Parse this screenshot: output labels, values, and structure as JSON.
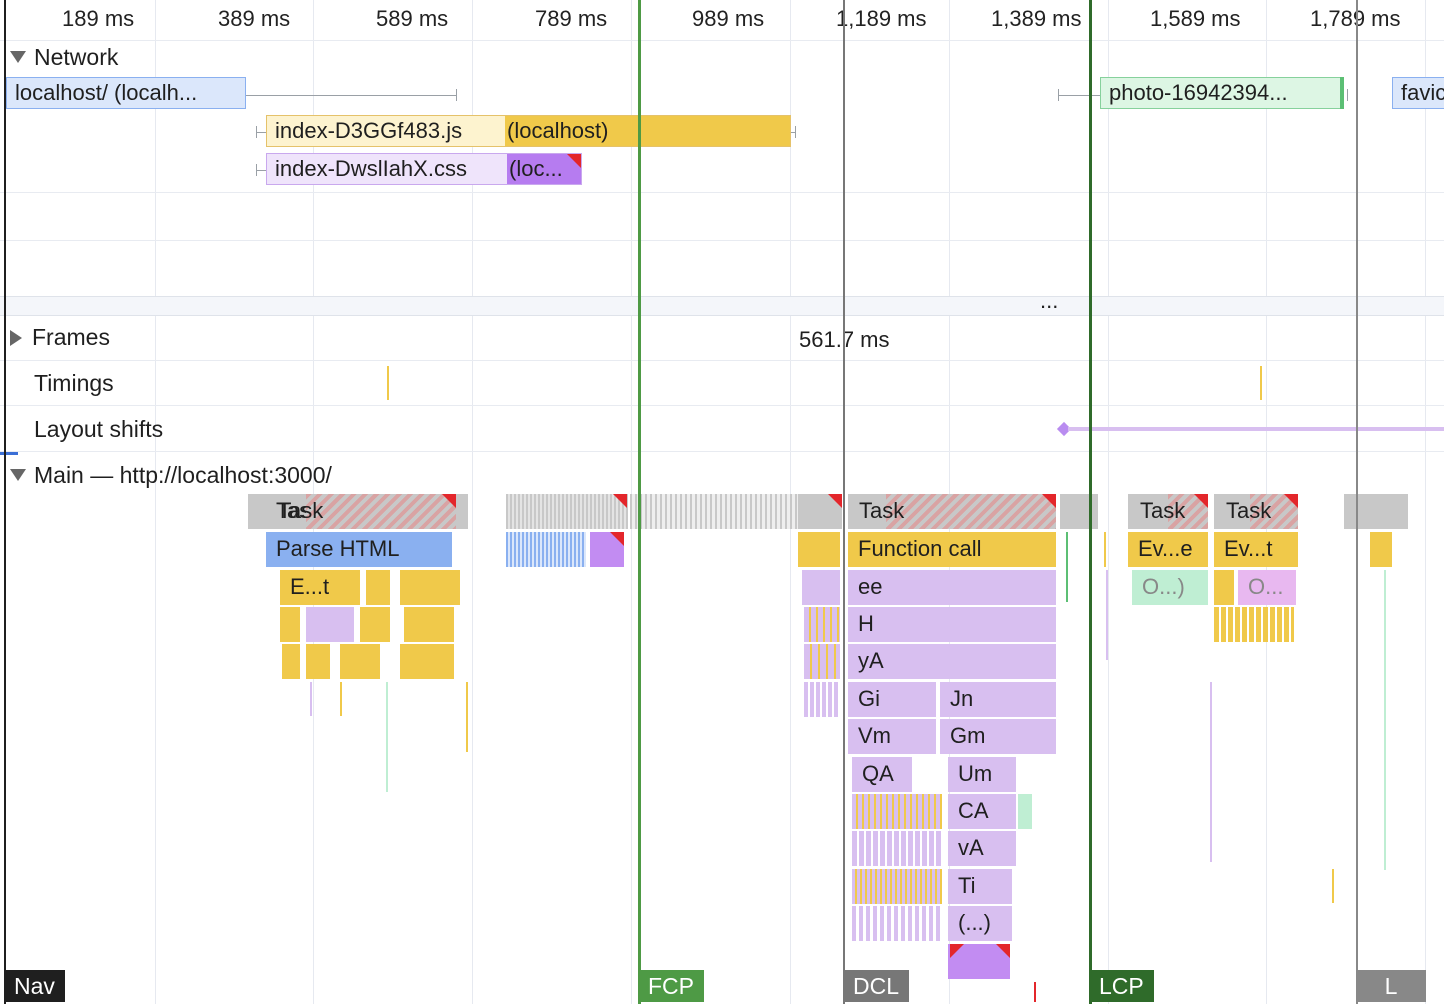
{
  "ruler": {
    "ticks": [
      "189 ms",
      "389 ms",
      "589 ms",
      "789 ms",
      "989 ms",
      "1,189 ms",
      "1,389 ms",
      "1,589 ms",
      "1,789 ms"
    ]
  },
  "network": {
    "label": "Network",
    "requests": [
      {
        "label": "localhost/ (localh..."
      },
      {
        "label": "index-D3GGf483.js",
        "sublabel": "(localhost)"
      },
      {
        "label": "index-DwslIahX.css",
        "sublabel": "(loc..."
      },
      {
        "label": "photo-16942394..."
      },
      {
        "label": "favic"
      }
    ]
  },
  "divider": {
    "dots": "..."
  },
  "tracks": {
    "frames": {
      "label": "Frames",
      "duration": "561.7 ms"
    },
    "timings": {
      "label": "Timings"
    },
    "layout_shifts": {
      "label": "Layout shifts"
    },
    "main": {
      "label": "Main — http://localhost:3000/"
    }
  },
  "flame": {
    "task1": "Task",
    "parse_html": "Parse HTML",
    "et": "E...t",
    "task2": "Task",
    "function_call": "Function call",
    "ee": "ee",
    "h": "H",
    "ya": "yA",
    "gi": "Gi",
    "jn": "Jn",
    "vm": "Vm",
    "gm": "Gm",
    "qa": "QA",
    "um": "Um",
    "ca": "CA",
    "va": "vA",
    "ti": "Ti",
    "ellipsis": "(...)",
    "task3": "Task",
    "task4": "Task",
    "eve": "Ev...e",
    "evt": "Ev...t",
    "o1": "O...)",
    "o2": "O..."
  },
  "markers": {
    "nav": "Nav",
    "fcp": "FCP",
    "dcl": "DCL",
    "lcp": "LCP",
    "l": "L"
  },
  "colors": {
    "fcp": "#4e9a45",
    "lcp": "#2f6b2a",
    "nav": "#1f1f1f",
    "dcl": "#777777",
    "l": "#888888"
  }
}
